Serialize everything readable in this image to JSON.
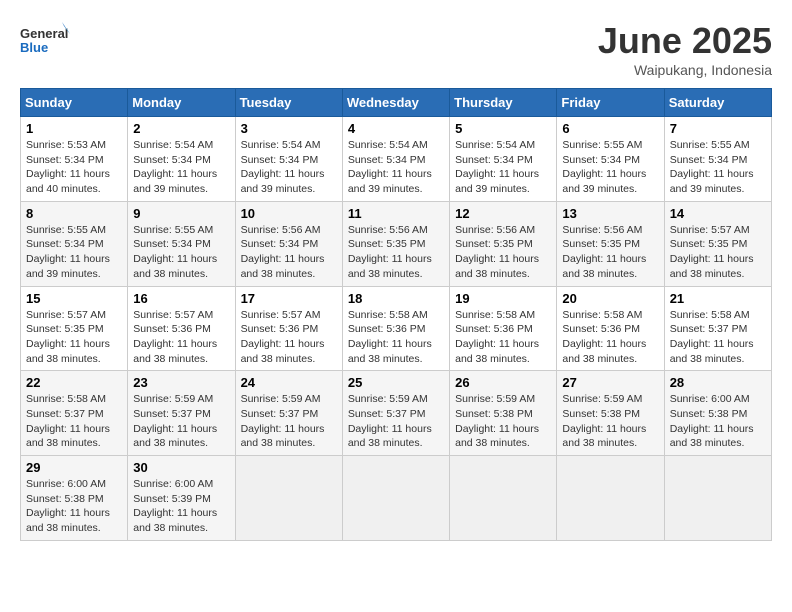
{
  "logo": {
    "text_general": "General",
    "text_blue": "Blue"
  },
  "header": {
    "month": "June 2025",
    "location": "Waipukang, Indonesia"
  },
  "weekdays": [
    "Sunday",
    "Monday",
    "Tuesday",
    "Wednesday",
    "Thursday",
    "Friday",
    "Saturday"
  ],
  "weeks": [
    [
      {
        "day": "1",
        "sunrise": "5:53 AM",
        "sunset": "5:34 PM",
        "daylight": "11 hours and 40 minutes."
      },
      {
        "day": "2",
        "sunrise": "5:54 AM",
        "sunset": "5:34 PM",
        "daylight": "11 hours and 39 minutes."
      },
      {
        "day": "3",
        "sunrise": "5:54 AM",
        "sunset": "5:34 PM",
        "daylight": "11 hours and 39 minutes."
      },
      {
        "day": "4",
        "sunrise": "5:54 AM",
        "sunset": "5:34 PM",
        "daylight": "11 hours and 39 minutes."
      },
      {
        "day": "5",
        "sunrise": "5:54 AM",
        "sunset": "5:34 PM",
        "daylight": "11 hours and 39 minutes."
      },
      {
        "day": "6",
        "sunrise": "5:55 AM",
        "sunset": "5:34 PM",
        "daylight": "11 hours and 39 minutes."
      },
      {
        "day": "7",
        "sunrise": "5:55 AM",
        "sunset": "5:34 PM",
        "daylight": "11 hours and 39 minutes."
      }
    ],
    [
      {
        "day": "8",
        "sunrise": "5:55 AM",
        "sunset": "5:34 PM",
        "daylight": "11 hours and 39 minutes."
      },
      {
        "day": "9",
        "sunrise": "5:55 AM",
        "sunset": "5:34 PM",
        "daylight": "11 hours and 38 minutes."
      },
      {
        "day": "10",
        "sunrise": "5:56 AM",
        "sunset": "5:34 PM",
        "daylight": "11 hours and 38 minutes."
      },
      {
        "day": "11",
        "sunrise": "5:56 AM",
        "sunset": "5:35 PM",
        "daylight": "11 hours and 38 minutes."
      },
      {
        "day": "12",
        "sunrise": "5:56 AM",
        "sunset": "5:35 PM",
        "daylight": "11 hours and 38 minutes."
      },
      {
        "day": "13",
        "sunrise": "5:56 AM",
        "sunset": "5:35 PM",
        "daylight": "11 hours and 38 minutes."
      },
      {
        "day": "14",
        "sunrise": "5:57 AM",
        "sunset": "5:35 PM",
        "daylight": "11 hours and 38 minutes."
      }
    ],
    [
      {
        "day": "15",
        "sunrise": "5:57 AM",
        "sunset": "5:35 PM",
        "daylight": "11 hours and 38 minutes."
      },
      {
        "day": "16",
        "sunrise": "5:57 AM",
        "sunset": "5:36 PM",
        "daylight": "11 hours and 38 minutes."
      },
      {
        "day": "17",
        "sunrise": "5:57 AM",
        "sunset": "5:36 PM",
        "daylight": "11 hours and 38 minutes."
      },
      {
        "day": "18",
        "sunrise": "5:58 AM",
        "sunset": "5:36 PM",
        "daylight": "11 hours and 38 minutes."
      },
      {
        "day": "19",
        "sunrise": "5:58 AM",
        "sunset": "5:36 PM",
        "daylight": "11 hours and 38 minutes."
      },
      {
        "day": "20",
        "sunrise": "5:58 AM",
        "sunset": "5:36 PM",
        "daylight": "11 hours and 38 minutes."
      },
      {
        "day": "21",
        "sunrise": "5:58 AM",
        "sunset": "5:37 PM",
        "daylight": "11 hours and 38 minutes."
      }
    ],
    [
      {
        "day": "22",
        "sunrise": "5:58 AM",
        "sunset": "5:37 PM",
        "daylight": "11 hours and 38 minutes."
      },
      {
        "day": "23",
        "sunrise": "5:59 AM",
        "sunset": "5:37 PM",
        "daylight": "11 hours and 38 minutes."
      },
      {
        "day": "24",
        "sunrise": "5:59 AM",
        "sunset": "5:37 PM",
        "daylight": "11 hours and 38 minutes."
      },
      {
        "day": "25",
        "sunrise": "5:59 AM",
        "sunset": "5:37 PM",
        "daylight": "11 hours and 38 minutes."
      },
      {
        "day": "26",
        "sunrise": "5:59 AM",
        "sunset": "5:38 PM",
        "daylight": "11 hours and 38 minutes."
      },
      {
        "day": "27",
        "sunrise": "5:59 AM",
        "sunset": "5:38 PM",
        "daylight": "11 hours and 38 minutes."
      },
      {
        "day": "28",
        "sunrise": "6:00 AM",
        "sunset": "5:38 PM",
        "daylight": "11 hours and 38 minutes."
      }
    ],
    [
      {
        "day": "29",
        "sunrise": "6:00 AM",
        "sunset": "5:38 PM",
        "daylight": "11 hours and 38 minutes."
      },
      {
        "day": "30",
        "sunrise": "6:00 AM",
        "sunset": "5:39 PM",
        "daylight": "11 hours and 38 minutes."
      },
      null,
      null,
      null,
      null,
      null
    ]
  ]
}
